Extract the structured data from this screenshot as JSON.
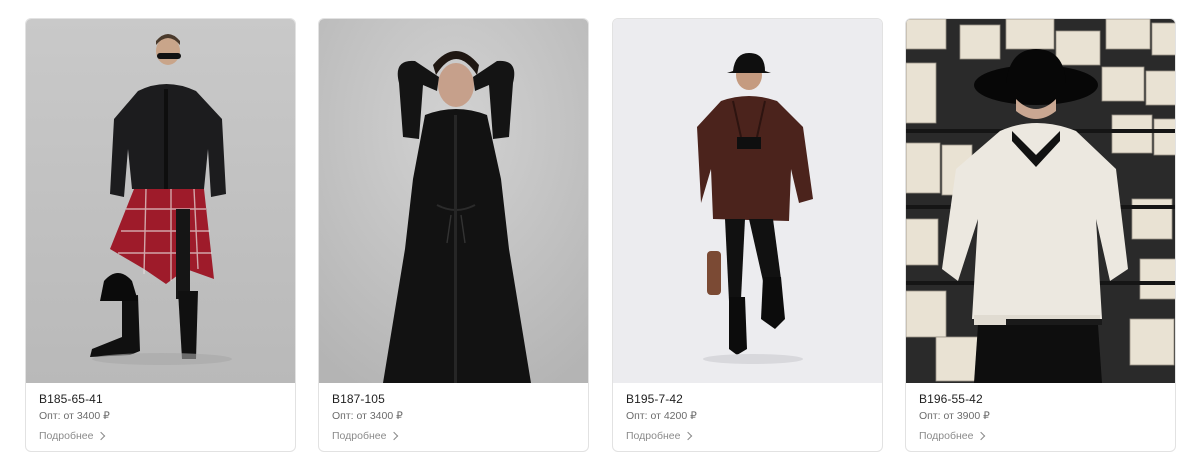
{
  "products": [
    {
      "sku": "В185-65-41",
      "price": "Опт: от 3400 ₽",
      "more": "Подробнее",
      "bg": "#c8c8c8"
    },
    {
      "sku": "В187-105",
      "price": "Опт: от 3400 ₽",
      "more": "Подробнее",
      "bg": "#c6c6c6"
    },
    {
      "sku": "В195-7-42",
      "price": "Опт: от 4200 ₽",
      "more": "Подробнее",
      "bg": "#eeeef0"
    },
    {
      "sku": "В196-55-42",
      "price": "Опт: от 3900 ₽",
      "more": "Подробнее",
      "bg": "#2a2a2a"
    }
  ],
  "colors": {
    "card_border": "#e2e2e2",
    "text": "#1f1f1f",
    "muted": "#6b6b6b"
  }
}
